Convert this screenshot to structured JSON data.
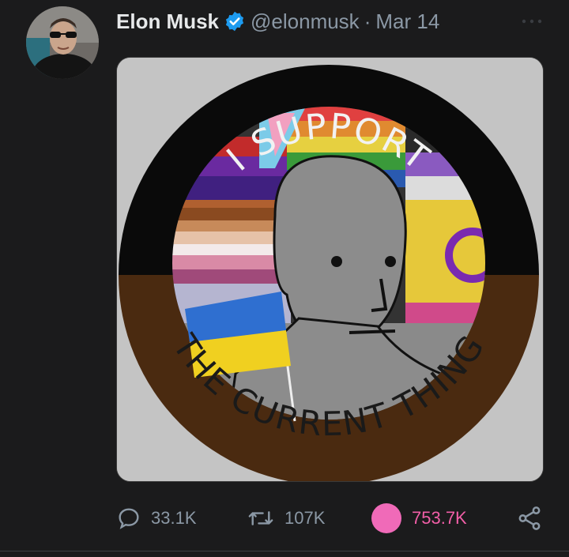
{
  "author": {
    "name": "Elon Musk",
    "handle": "@elonmusk",
    "separator": "·",
    "date": "Mar 14",
    "verified": true,
    "avatar": "profile-photo"
  },
  "media": {
    "top_text": "I SUPPORT",
    "bottom_text": "THE CURRENT THING",
    "colors": {
      "background": "#c4c4c4",
      "ring_top": "#0a0a0a",
      "ring_bottom": "#4a2a10",
      "face": "#8a8a8a"
    }
  },
  "stats": {
    "replies": "33.1K",
    "retweets": "107K",
    "likes": "753.7K"
  },
  "icons": {
    "reply": "reply-bubble-icon",
    "retweet": "retweet-icon",
    "like": "like-dot-icon",
    "share": "share-icon",
    "more": "more-dots-icon",
    "verified": "verified-badge-icon"
  },
  "colors": {
    "background": "#1b1b1c",
    "text": "#e7e9ea",
    "muted": "#8b98a5",
    "verified_blue": "#1d9bf0",
    "like_pink": "#f25fa8"
  }
}
